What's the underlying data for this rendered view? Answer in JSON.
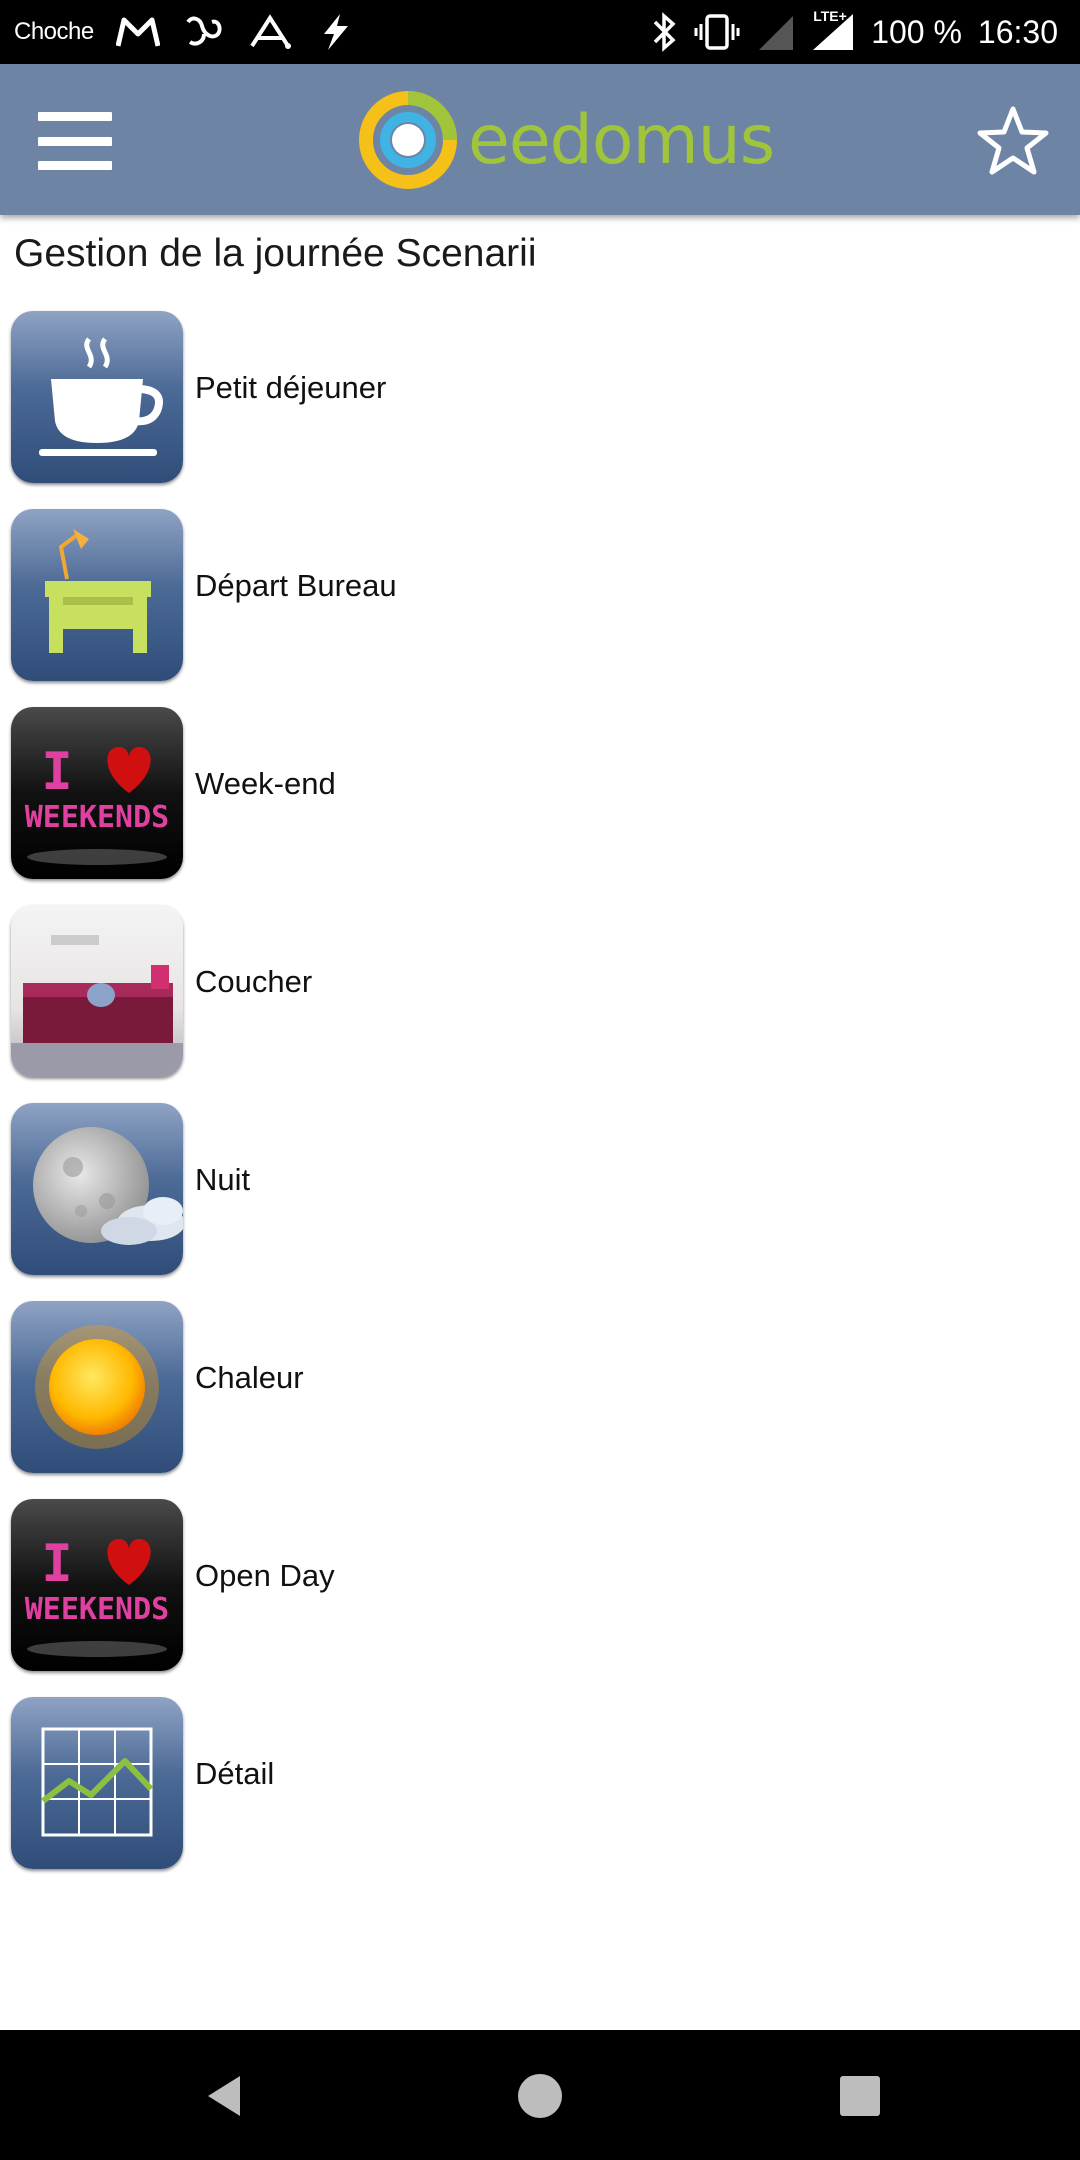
{
  "status_bar": {
    "carrier": "Choche",
    "battery": "100 %",
    "time": "16:30",
    "network_badge": "LTE+"
  },
  "app_bar": {
    "logo_text": "eedomus",
    "menu_icon": "hamburger-menu-icon",
    "favorite_icon": "star-icon"
  },
  "page": {
    "title": "Gestion de la journée Scenarii"
  },
  "scenarios": [
    {
      "label": "Petit déjeuner",
      "icon": "coffee-cup-icon"
    },
    {
      "label": "Départ Bureau",
      "icon": "desk-lamp-icon"
    },
    {
      "label": "Week-end",
      "icon": "i-love-weekends-icon"
    },
    {
      "label": "Coucher",
      "icon": "bedroom-photo-icon"
    },
    {
      "label": "Nuit",
      "icon": "moon-cloud-icon"
    },
    {
      "label": "Chaleur",
      "icon": "sun-icon"
    },
    {
      "label": "Open Day",
      "icon": "i-love-weekends-icon"
    },
    {
      "label": "Détail",
      "icon": "line-chart-icon"
    }
  ],
  "weekend_badge": {
    "line1": "I",
    "line2": "WEEKENDS"
  },
  "colors": {
    "status_bar": "#000000",
    "app_bar": "#6e84a5",
    "tile_blue": "#3d5a85",
    "logo_green": "#a0c43a",
    "logo_blue": "#3fb3e3",
    "logo_yellow": "#f5c018"
  }
}
